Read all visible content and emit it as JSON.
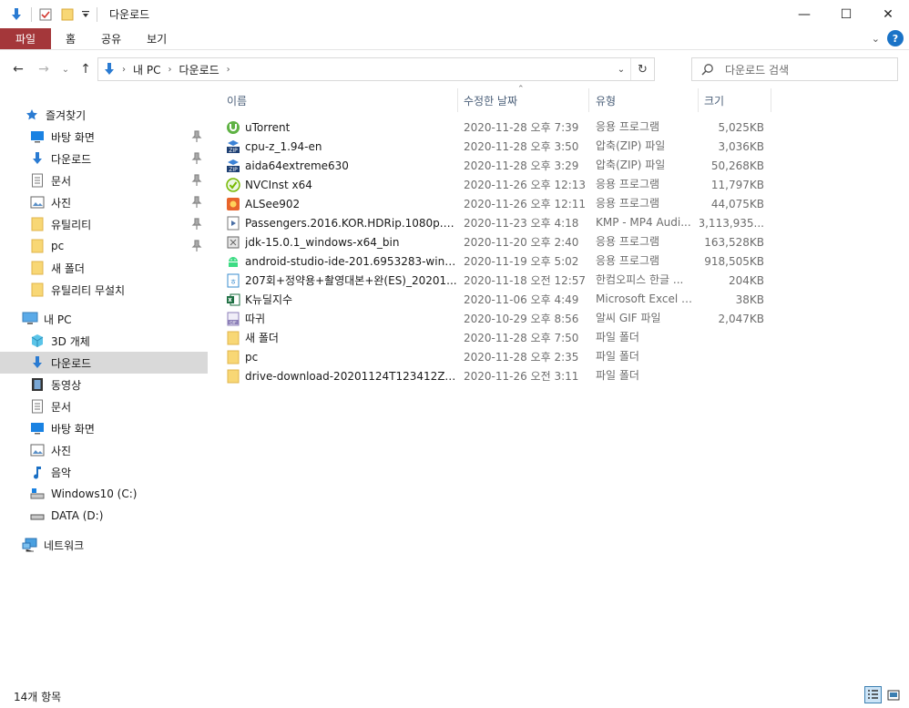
{
  "window": {
    "title": "다운로드",
    "controls": {
      "minimize": "—",
      "maximize": "☐",
      "close": "✕"
    }
  },
  "ribbon": {
    "tabs": [
      "파일",
      "홈",
      "공유",
      "보기"
    ],
    "help": "?",
    "collapse": "⌄"
  },
  "nav": {
    "back": "←",
    "forward": "→",
    "recent": "⌄",
    "up": "↑",
    "breadcrumb": [
      "내 PC",
      "다운로드"
    ],
    "refresh": "↻",
    "search_placeholder": "다운로드 검색"
  },
  "sidebar": {
    "items": [
      {
        "label": "즐겨찾기",
        "icon": "star-icon",
        "pinned": false
      },
      {
        "label": "바탕 화면",
        "icon": "desktop-icon",
        "pinned": true
      },
      {
        "label": "다운로드",
        "icon": "download-arrow-icon",
        "pinned": true
      },
      {
        "label": "문서",
        "icon": "document-icon",
        "pinned": true
      },
      {
        "label": "사진",
        "icon": "picture-icon",
        "pinned": true
      },
      {
        "label": "유틸리티",
        "icon": "folder-icon",
        "pinned": true
      },
      {
        "label": "pc",
        "icon": "folder-icon",
        "pinned": true
      },
      {
        "label": "새 폴더",
        "icon": "folder-icon",
        "pinned": false
      },
      {
        "label": "유틸리티 무설치",
        "icon": "folder-icon",
        "pinned": false
      },
      {
        "label": "내 PC",
        "icon": "computer-icon",
        "pinned": false
      },
      {
        "label": "3D 개체",
        "icon": "cube-3d-icon",
        "pinned": false
      },
      {
        "label": "다운로드",
        "icon": "download-arrow-icon",
        "pinned": false,
        "selected": true
      },
      {
        "label": "동영상",
        "icon": "film-icon",
        "pinned": false
      },
      {
        "label": "문서",
        "icon": "document-icon",
        "pinned": false
      },
      {
        "label": "바탕 화면",
        "icon": "desktop-icon",
        "pinned": false
      },
      {
        "label": "사진",
        "icon": "picture-icon",
        "pinned": false
      },
      {
        "label": "음악",
        "icon": "music-note-icon",
        "pinned": false
      },
      {
        "label": "Windows10 (C:)",
        "icon": "drive-windows-icon",
        "pinned": false
      },
      {
        "label": "DATA (D:)",
        "icon": "drive-icon",
        "pinned": false
      },
      {
        "label": "네트워크",
        "icon": "network-icon",
        "pinned": false
      }
    ]
  },
  "columns": {
    "name": "이름",
    "date": "수정한 날짜",
    "type": "유형",
    "size": "크기",
    "sort_indicator": "⌃"
  },
  "files": [
    {
      "name": "uTorrent",
      "date": "2020-11-28 오후 7:39",
      "type": "응용 프로그램",
      "size": "5,025KB",
      "icon": "utorrent-icon"
    },
    {
      "name": "cpu-z_1.94-en",
      "date": "2020-11-28 오후 3:50",
      "type": "압축(ZIP) 파일",
      "size": "3,036KB",
      "icon": "zip-icon"
    },
    {
      "name": "aida64extreme630",
      "date": "2020-11-28 오후 3:29",
      "type": "압축(ZIP) 파일",
      "size": "50,268KB",
      "icon": "zip-icon"
    },
    {
      "name": "NVCInst x64",
      "date": "2020-11-26 오후 12:13",
      "type": "응용 프로그램",
      "size": "11,797KB",
      "icon": "nvidia-check-icon"
    },
    {
      "name": "ALSee902",
      "date": "2020-11-26 오후 12:11",
      "type": "응용 프로그램",
      "size": "44,075KB",
      "icon": "alsee-icon"
    },
    {
      "name": "Passengers.2016.KOR.HDRip.1080p.H26...",
      "date": "2020-11-23 오후 4:18",
      "type": "KMP - MP4 Audi...",
      "size": "3,113,935...",
      "icon": "video-file-icon"
    },
    {
      "name": "jdk-15.0.1_windows-x64_bin",
      "date": "2020-11-20 오후 2:40",
      "type": "응용 프로그램",
      "size": "163,528KB",
      "icon": "installer-icon"
    },
    {
      "name": "android-studio-ide-201.6953283-windo...",
      "date": "2020-11-19 오후 5:02",
      "type": "응용 프로그램",
      "size": "918,505KB",
      "icon": "android-icon"
    },
    {
      "name": "207회+정약용+촬영대본+완(ES)_20201...",
      "date": "2020-11-18 오전 12:57",
      "type": "한컴오피스 한글 ...",
      "size": "204KB",
      "icon": "hwp-icon"
    },
    {
      "name": "K뉴딜지수",
      "date": "2020-11-06 오후 4:49",
      "type": "Microsoft Excel 9...",
      "size": "38KB",
      "icon": "excel-icon"
    },
    {
      "name": "따귀",
      "date": "2020-10-29 오후 8:56",
      "type": "알씨 GIF 파일",
      "size": "2,047KB",
      "icon": "gif-icon"
    },
    {
      "name": "새 폴더",
      "date": "2020-11-28 오후 7:50",
      "type": "파일 폴더",
      "size": "",
      "icon": "folder-icon"
    },
    {
      "name": "pc",
      "date": "2020-11-28 오후 2:35",
      "type": "파일 폴더",
      "size": "",
      "icon": "folder-icon"
    },
    {
      "name": "drive-download-20201124T123412Z-001",
      "date": "2020-11-26 오전 3:11",
      "type": "파일 폴더",
      "size": "",
      "icon": "folder-icon"
    }
  ],
  "status": {
    "count": "14개 항목"
  },
  "colors": {
    "file_tab": "#a4373a",
    "selected": "#d9d9d9",
    "accent": "#1a73c7",
    "folder": "#f8d775"
  }
}
